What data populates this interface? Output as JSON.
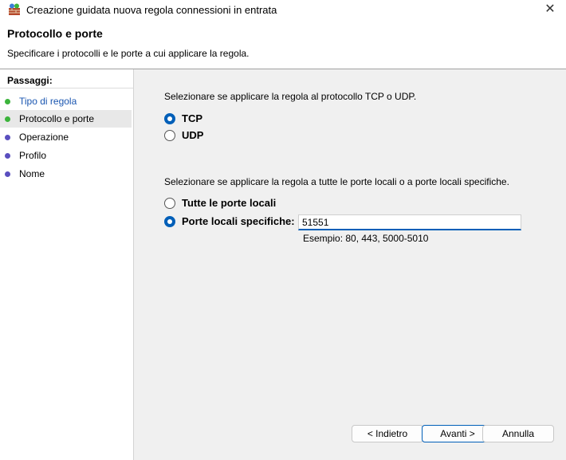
{
  "window": {
    "title": "Creazione guidata nuova regola connessioni in entrata",
    "close_glyph": "✕"
  },
  "header": {
    "title": "Protocollo e porte",
    "subtitle": "Specificare i protocolli e le porte a cui applicare la regola."
  },
  "steps": {
    "title": "Passaggi:",
    "items": [
      {
        "label": "Tipo di regola",
        "state": "done",
        "dot_color": "#3cb43c"
      },
      {
        "label": "Protocollo e porte",
        "state": "current",
        "dot_color": "#3cb43c"
      },
      {
        "label": "Operazione",
        "state": "pending",
        "dot_color": "#5a4fbf"
      },
      {
        "label": "Profilo",
        "state": "pending",
        "dot_color": "#5a4fbf"
      },
      {
        "label": "Nome",
        "state": "pending",
        "dot_color": "#5a4fbf"
      }
    ]
  },
  "protocol": {
    "prompt": "Selezionare se applicare la regola al protocollo TCP o UDP.",
    "options": [
      {
        "label": "TCP",
        "checked": true
      },
      {
        "label": "UDP",
        "checked": false
      }
    ]
  },
  "ports": {
    "prompt": "Selezionare se applicare la regola a tutte le porte locali o a porte locali specifiche.",
    "options": [
      {
        "label": "Tutte le porte locali",
        "checked": false
      },
      {
        "label": "Porte locali specifiche:",
        "checked": true
      }
    ],
    "value": "51551",
    "example": "Esempio: 80, 443, 5000-5010"
  },
  "buttons": {
    "back": "< Indietro",
    "next": "Avanti >",
    "cancel": "Annulla"
  },
  "colors": {
    "accent": "#005fb8"
  }
}
